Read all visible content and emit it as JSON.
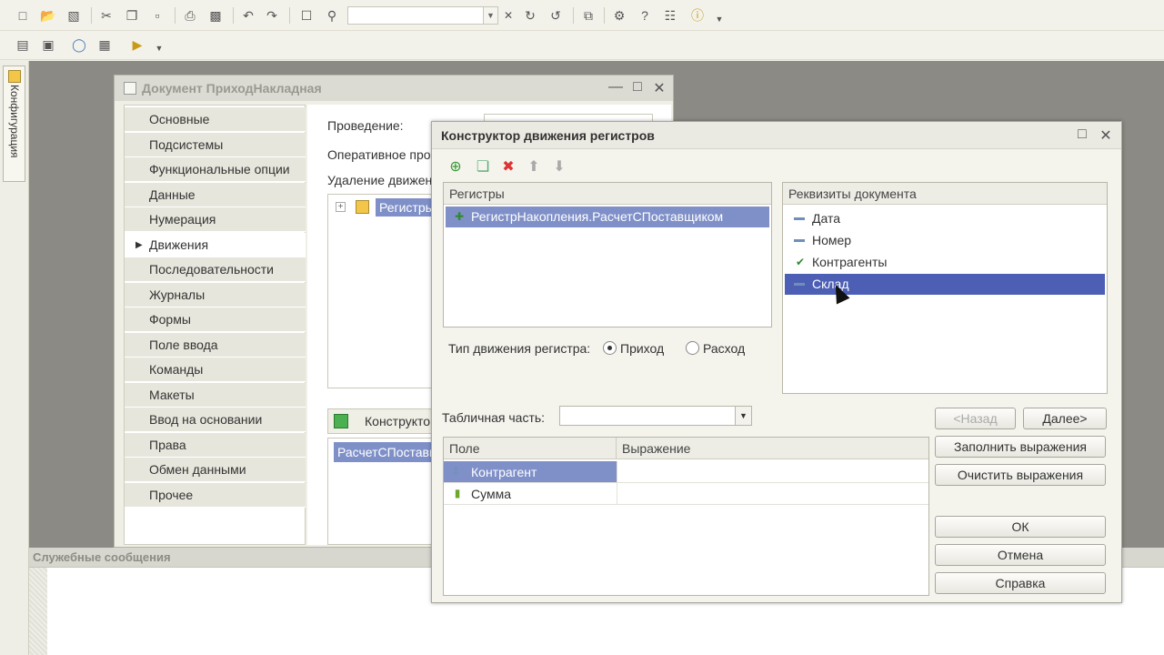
{
  "toolbar": {
    "icons": [
      "new-icon",
      "open-icon",
      "save-icon",
      "cut-icon",
      "copy-icon",
      "paste-icon",
      "print-icon",
      "preview-icon",
      "undo-icon",
      "redo-icon",
      "find-icon",
      "search-icon",
      "search-field",
      "refresh-icon",
      "back-icon",
      "windows-icon",
      "wizard-icon",
      "help-search-icon",
      "help-icon",
      "info-icon"
    ],
    "search_value": ""
  },
  "config_tab": {
    "label": "Конфигурация"
  },
  "messages": {
    "title": "Служебные сообщения"
  },
  "document_window": {
    "title": "Документ ПриходНакладная",
    "nav_items": [
      "Основные",
      "Подсистемы",
      "Функциональные опции",
      "Данные",
      "Нумерация",
      "Движения",
      "Последовательности",
      "Журналы",
      "Формы",
      "Поле ввода",
      "Команды",
      "Макеты",
      "Ввод на основании",
      "Права",
      "Обмен данными",
      "Прочее"
    ],
    "active_nav": "Движения",
    "labels": {
      "posting": "Проведение:",
      "operative": "Оперативное прове",
      "delete": "Удаление движен",
      "tree_item": "Регистры",
      "constructor": "Конструкто",
      "list_item": "РасчетСПоставщ"
    }
  },
  "dialog": {
    "title": "Конструктор движения регистров",
    "registers": {
      "header": "Регистры",
      "items": [
        "РегистрНакопления.РасчетСПоставщиком"
      ]
    },
    "attributes": {
      "header": "Реквизиты документа",
      "items": [
        "Дата",
        "Номер",
        "Контрагенты",
        "Склад"
      ],
      "selected": "Склад"
    },
    "movement_type": {
      "label": "Тип движения регистра:",
      "options": [
        "Приход",
        "Расход"
      ],
      "selected": "Приход"
    },
    "tabular_part": {
      "label": "Табличная часть:",
      "value": ""
    },
    "grid": {
      "columns": [
        "Поле",
        "Выражение"
      ],
      "rows": [
        {
          "field": "Контрагент",
          "expression": ""
        },
        {
          "field": "Сумма",
          "expression": ""
        }
      ]
    },
    "buttons": {
      "back": "<Назад",
      "next": "Далее>",
      "fill": "Заполнить выражения",
      "clear": "Очистить выражения",
      "ok": "ОК",
      "cancel": "Отмена",
      "help": "Справка"
    }
  }
}
